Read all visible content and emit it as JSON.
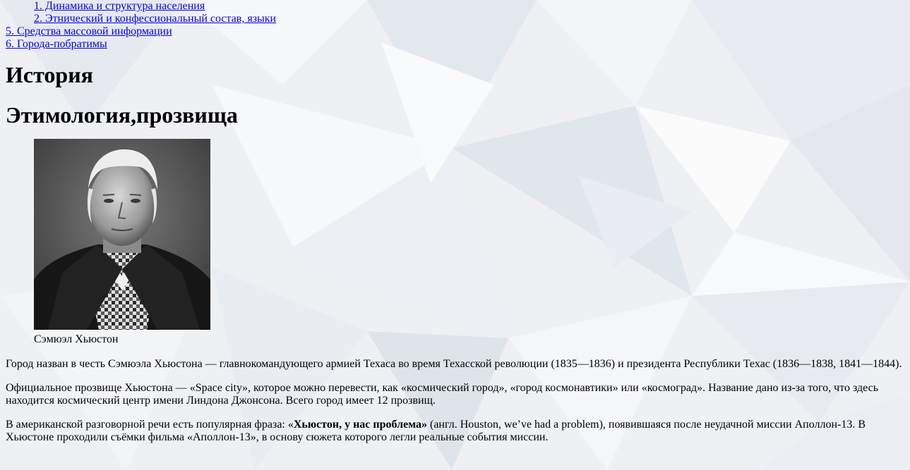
{
  "toc": {
    "items": [
      {
        "label": "1. Динамика и структура населения",
        "sub": true
      },
      {
        "label": "2. Этнический и конфессиональный состав, языки",
        "sub": true
      },
      {
        "label": "5. Средства массовой информации",
        "sub": false
      },
      {
        "label": "6. Города-побратимы",
        "sub": false
      }
    ]
  },
  "article": {
    "section_title": "История",
    "subsection_title": "Этимология,прозвища",
    "figure": {
      "caption": "Сэмюэл Хьюстон"
    },
    "paragraphs": {
      "p1": "Город назван в честь Сэмюэла Хьюстона — главнокомандующего армией Техаса во время Техасской революции (1835—1836) и президента Республики Техас (1836—1838, 1841—1844).",
      "p2": "Официальное прозвище Хьюстона — «Space city», которое можно перевести, как «космический город», «город космонавтики» или «космоград». Название дано из-за того, что здесь находится космический центр имени Линдона Джонсона. Всего город имеет 12 прозвищ.",
      "p3_before": "В американской разговорной речи есть популярная фраза: «",
      "p3_bold": "Хьюстон, у нас проблема»",
      "p3_after": " (англ. Houston, we’ve had a problem), появившаяся после неудачной миссии Аполлон-13. В Хьюстоне проходили съёмки фильма «Аполлон-13», в основу сюжета которого легли реальные события миссии."
    }
  }
}
